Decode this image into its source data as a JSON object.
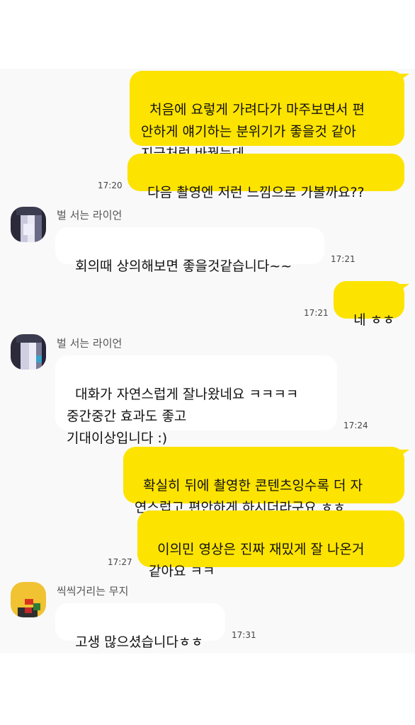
{
  "messages": {
    "m1": {
      "text": "처음에 요렇게 가려다가 마주보면서 편\n안하게 얘기하는 분위기가 좋을것 같아\n지금처럼 바꿨는데"
    },
    "m2": {
      "text": "다음 촬영엔 저런 느낌으로 가볼까요??",
      "time": "17:20"
    },
    "m3": {
      "sender": "벌 서는 라이언",
      "text": "회의때 상의해보면 좋을것같습니다~~",
      "time": "17:21"
    },
    "m4": {
      "text": "네 ㅎㅎ",
      "time": "17:21"
    },
    "m5": {
      "sender": "벌 서는 라이언",
      "text": "대화가 자연스럽게 잘나왔네요 ㅋㅋㅋㅋ\n중간중간 효과도 좋고\n기대이상입니다 :)",
      "time": "17:24"
    },
    "m6": {
      "text": "확실히 뒤에 촬영한 콘텐츠잉수록 더 자\n연스럽고 편안하게 하시더라구요 ㅎㅎ"
    },
    "m7": {
      "text": "이의민 영상은 진짜 재밌게 잘 나온거\n같아요 ㅋㅋ",
      "time": "17:27"
    },
    "m8": {
      "sender": "씩씩거리는 무지",
      "text": "고생 많으셨습니다ㅎㅎ",
      "time": "17:31"
    }
  },
  "colors": {
    "my_bubble": "#fde300",
    "their_bubble": "#ffffff",
    "chat_bg": "#f9f9f9"
  },
  "icons": {
    "avatar1": "blurred-ryan-avatar",
    "avatar2": "blurred-ryan-avatar",
    "avatar3": "blurred-muzi-avatar"
  }
}
